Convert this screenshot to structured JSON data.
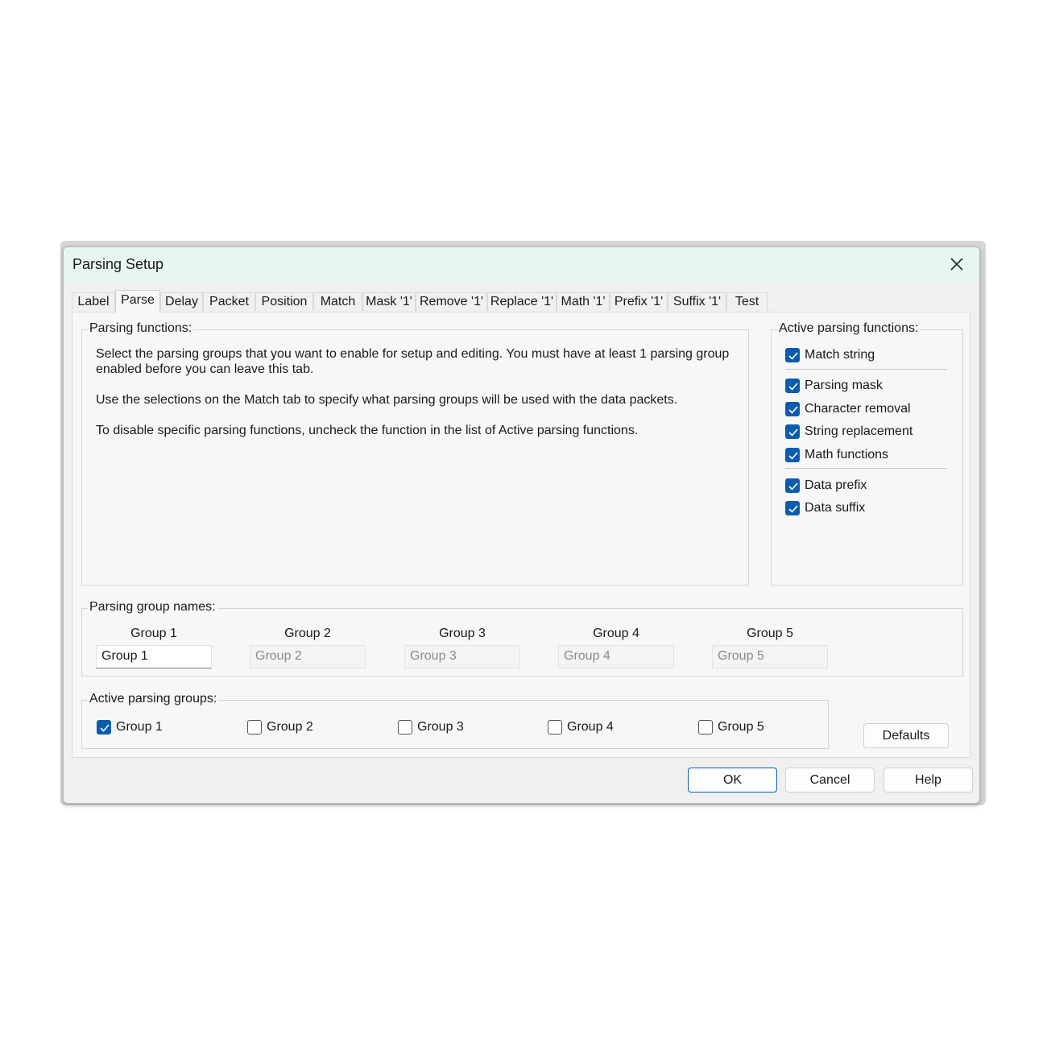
{
  "dialog": {
    "title": "Parsing Setup"
  },
  "tabs": [
    {
      "label": "Label"
    },
    {
      "label": "Parse"
    },
    {
      "label": "Delay"
    },
    {
      "label": "Packet"
    },
    {
      "label": "Position"
    },
    {
      "label": "Match"
    },
    {
      "label": "Mask '1'"
    },
    {
      "label": "Remove '1'"
    },
    {
      "label": "Replace '1'"
    },
    {
      "label": "Math '1'"
    },
    {
      "label": "Prefix '1'"
    },
    {
      "label": "Suffix '1'"
    },
    {
      "label": "Test"
    }
  ],
  "active_tab": "Parse",
  "parsing_functions": {
    "title": "Parsing functions:",
    "paragraphs": [
      "Select the parsing groups that you want to enable for setup and editing.  You must have at least 1 parsing group enabled before you can leave this tab.",
      "Use the selections on the Match tab to specify what parsing groups will be used with the data packets.",
      "To disable specific parsing functions, uncheck the function in the list of Active parsing functions."
    ]
  },
  "active_functions": {
    "title": "Active parsing functions:",
    "items": [
      {
        "label": "Match string",
        "checked": true
      },
      {
        "label": "Parsing mask",
        "checked": true
      },
      {
        "label": "Character removal",
        "checked": true
      },
      {
        "label": "String replacement",
        "checked": true
      },
      {
        "label": "Math functions",
        "checked": true
      },
      {
        "label": "Data prefix",
        "checked": true
      },
      {
        "label": "Data suffix",
        "checked": true
      }
    ]
  },
  "group_names": {
    "title": "Parsing group names:",
    "columns": [
      {
        "header": "Group 1",
        "value": "Group 1",
        "enabled": true
      },
      {
        "header": "Group 2",
        "value": "Group 2",
        "enabled": false
      },
      {
        "header": "Group 3",
        "value": "Group 3",
        "enabled": false
      },
      {
        "header": "Group 4",
        "value": "Group 4",
        "enabled": false
      },
      {
        "header": "Group 5",
        "value": "Group 5",
        "enabled": false
      }
    ]
  },
  "active_groups": {
    "title": "Active parsing groups:",
    "items": [
      {
        "label": "Group 1",
        "checked": true
      },
      {
        "label": "Group 2",
        "checked": false
      },
      {
        "label": "Group 3",
        "checked": false
      },
      {
        "label": "Group 4",
        "checked": false
      },
      {
        "label": "Group 5",
        "checked": false
      }
    ]
  },
  "buttons": {
    "defaults": "Defaults",
    "ok": "OK",
    "cancel": "Cancel",
    "help": "Help"
  },
  "colors": {
    "accent": "#0b5cad",
    "titlebar": "#e8f6f3"
  }
}
